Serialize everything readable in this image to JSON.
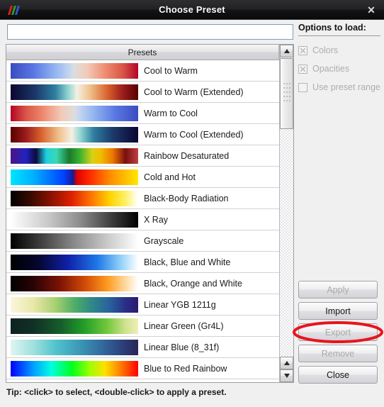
{
  "window": {
    "title": "Choose Preset",
    "logo_icon": "paraview-logo-icon",
    "close_icon": "close-icon"
  },
  "filter": {
    "value": "",
    "placeholder": ""
  },
  "list": {
    "header": "Presets",
    "rows": [
      {
        "name": "Cool to Warm",
        "gradient": "linear-gradient(to right, #3b4cc0 0%, #5977e3 18%, #93b5f0 35%, #c9d8ef 47%, #dddddd 50%, #f2cbb7 60%, #ee8468 76%, #d85646 88%, #b40426 100%)"
      },
      {
        "name": "Cool to Warm (Extended)",
        "gradient": "linear-gradient(to right, #0b0530 0%, #1b3a6b 20%, #2f7fa0 35%, #8fd4d0 45%, #f4f0e4 52%, #f0c28c 62%, #d9622d 76%, #9b1c1c 88%, #580000 100%)"
      },
      {
        "name": "Warm to Cool",
        "gradient": "linear-gradient(to right, #b40426 0%, #d85646 12%, #ee8468 24%, #f2cbb7 40%, #dddddd 50%, #c9d8ef 53%, #93b5f0 65%, #5977e3 82%, #3b4cc0 100%)"
      },
      {
        "name": "Warm to Cool (Extended)",
        "gradient": "linear-gradient(to right, #580000 0%, #9b1c1c 12%, #d9622d 24%, #f0c28c 38%, #f4f0e4 48%, #8fd4d0 55%, #2f7fa0 65%, #1b3a6b 80%, #0b0530 100%)"
      },
      {
        "name": "Rainbow Desaturated",
        "gradient": "linear-gradient(to right, #4a1486 0%, #2222c0 12%, #0b0b3a 20%, #1ecfe0 28%, #3ad8b0 36%, #1a7a2a 46%, #37b030 54%, #d6d216 64%, #f0c000 70%, #ee7700 80%, #7a0f0f 90%, #c04040 100%)"
      },
      {
        "name": "Cold and Hot",
        "gradient": "linear-gradient(to right, #00e5ff 0%, #00b0ff 18%, #0040ff 42%, #1a1a8c 49%, #e00000 52%, #ff2a00 62%, #ff8c00 78%, #ffe800 100%)"
      },
      {
        "name": "Black-Body Radiation",
        "gradient": "linear-gradient(to right, #000000 0%, #3a0a00 16%, #8c1200 32%, #e02000 48%, #ff7a00 64%, #ffd400 78%, #fff066 90%, #ffffff 100%)"
      },
      {
        "name": "X Ray",
        "gradient": "linear-gradient(to right, #ffffff 0%, #c8c8c8 30%, #8a8a8a 55%, #3a3a3a 80%, #000000 100%)"
      },
      {
        "name": "Grayscale",
        "gradient": "linear-gradient(to right, #000000 0%, #3a3a3a 22%, #8a8a8a 50%, #c8c8c8 75%, #ffffff 100%)"
      },
      {
        "name": "Black, Blue and White",
        "gradient": "linear-gradient(to right, #000000 0%, #060630 22%, #1020a8 45%, #1e78e8 68%, #8fd0f8 86%, #ffffff 100%)"
      },
      {
        "name": "Black, Orange and White",
        "gradient": "linear-gradient(to right, #000000 0%, #2a0404 18%, #7a1205 38%, #d04a06 58%, #ff9b20 76%, #ffd9a0 90%, #ffffff 100%)"
      },
      {
        "name": "Linear YGB 1211g",
        "gradient": "linear-gradient(to right, #fbf6dc 0%, #e8e8a8 18%, #a8d072 35%, #4fae66 50%, #2f8a86 63%, #27609e 78%, #2a2f86 90%, #2b1a6e 100%)"
      },
      {
        "name": "Linear Green (Gr4L)",
        "gradient": "linear-gradient(to right, #0d2220 0%, #113026 18%, #15602a 40%, #22a027 58%, #74c83c 76%, #cfe28e 90%, #eef0b8 100%)"
      },
      {
        "name": "Linear Blue (8_31f)",
        "gradient": "linear-gradient(to right, #dff5f2 0%, #9fe0dc 18%, #4ec3cc 36%, #3a93b4 56%, #2f5f96 76%, #2b3570 92%, #2a2556 100%)"
      },
      {
        "name": "Blue to Red Rainbow",
        "gradient": "linear-gradient(to right, #0000ff 0%, #00a0ff 18%, #00ffe0 32%, #00ff20 48%, #9cff00 62%, #ffe000 74%, #ff8000 86%, #ff0000 100%)"
      }
    ],
    "partial_row_gradient": "linear-gradient(to right, #ff0000 0%, #ff8000 14%, #ffe000 28%, #9cff00 42%, #00ff20 56%, #00ffe0 70%, #00a0ff 85%, #0000ff 100%)"
  },
  "tip": "Tip: <click> to select, <double-click> to apply a preset.",
  "options": {
    "title": "Options to load:",
    "items": [
      {
        "label": "Colors",
        "checked": true,
        "enabled": false
      },
      {
        "label": "Opacities",
        "checked": true,
        "enabled": false
      },
      {
        "label": "Use preset range",
        "checked": false,
        "enabled": false
      }
    ]
  },
  "buttons": [
    {
      "label": "Apply",
      "enabled": false
    },
    {
      "label": "Import",
      "enabled": true
    },
    {
      "label": "Export",
      "enabled": false
    },
    {
      "label": "Remove",
      "enabled": false
    },
    {
      "label": "Close",
      "enabled": true
    }
  ],
  "annotation": {
    "target": "Import",
    "shape": "ellipse",
    "color": "#e8141e"
  },
  "scrollbar": {
    "up_icon": "arrow-up-icon",
    "down_icon": "arrow-down-icon"
  }
}
